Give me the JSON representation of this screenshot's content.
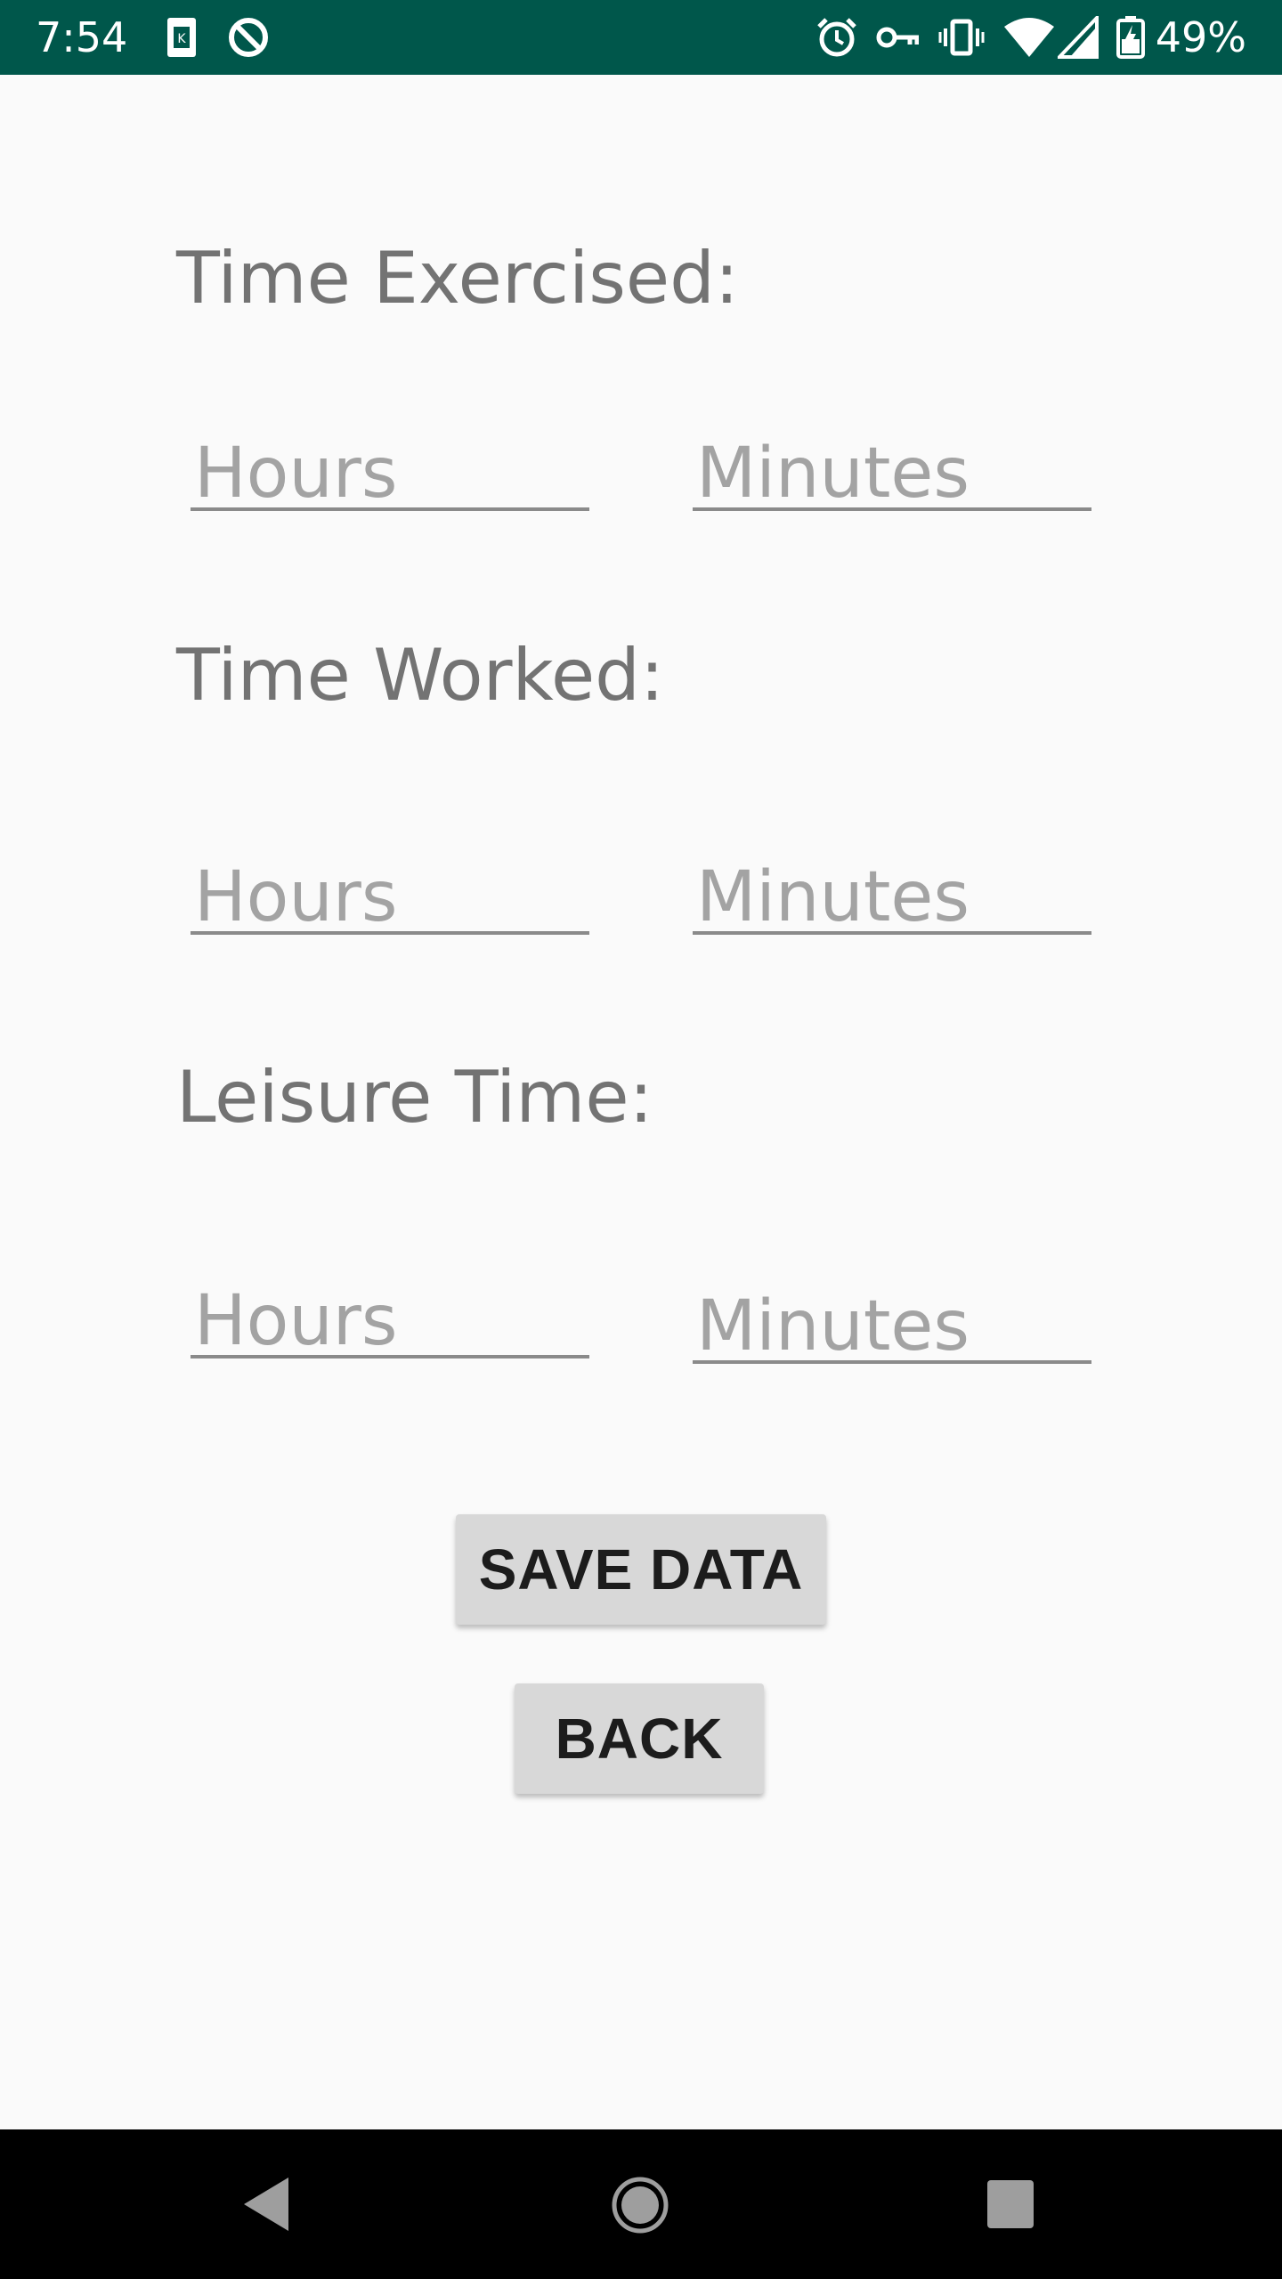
{
  "status_bar": {
    "time": "7:54",
    "battery_percent": "49%",
    "icons": [
      "sim-card-icon",
      "sync-disabled-icon",
      "alarm-icon",
      "vpn-key-icon",
      "vibrate-icon",
      "wifi-icon",
      "cell-signal-icon",
      "battery-charging-icon"
    ]
  },
  "form": {
    "exercise": {
      "label": "Time Exercised:",
      "hours_placeholder": "Hours",
      "minutes_placeholder": "Minutes"
    },
    "work": {
      "label": "Time Worked:",
      "hours_placeholder": "Hours",
      "minutes_placeholder": "Minutes"
    },
    "leisure": {
      "label": "Leisure Time:",
      "hours_placeholder": "Hours",
      "minutes_placeholder": "Minutes"
    }
  },
  "buttons": {
    "save_label": "SAVE DATA",
    "back_label": "BACK"
  },
  "nav_bar": {
    "icons": [
      "back-icon",
      "home-icon",
      "recents-icon"
    ]
  },
  "colors": {
    "status_bar_bg": "#00574b",
    "page_bg": "#fafafa",
    "button_bg": "#d8d8d8",
    "label_text": "#737373",
    "placeholder_text": "#a3a3a3"
  }
}
